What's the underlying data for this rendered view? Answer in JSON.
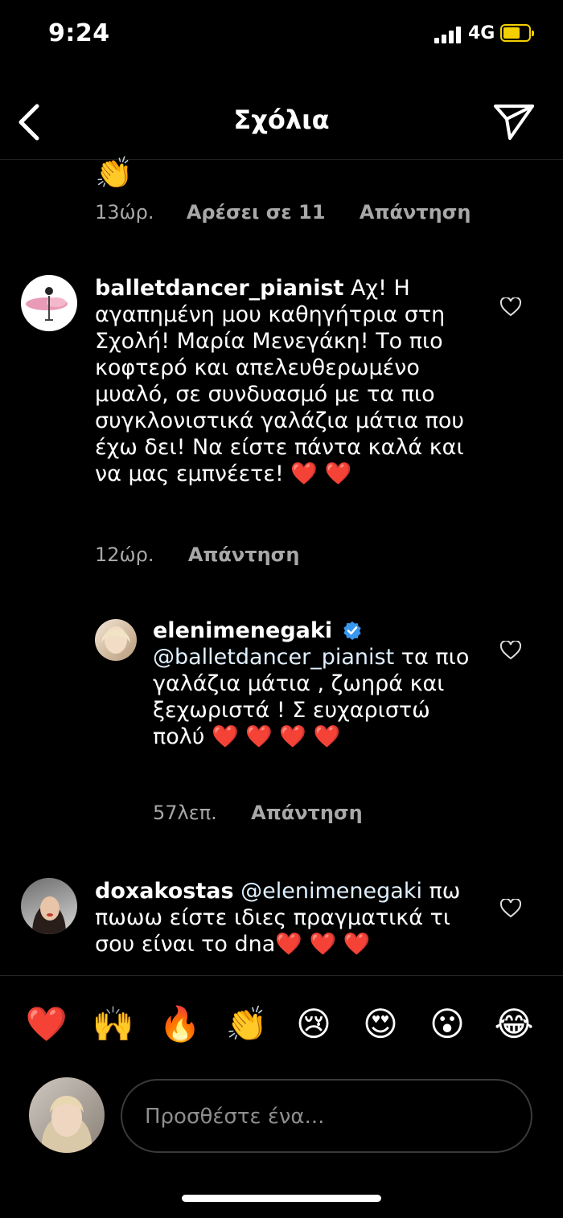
{
  "status": {
    "time": "9:24",
    "network": "4G"
  },
  "header": {
    "title": "Σχόλια"
  },
  "prev_comment": {
    "emoji": "👏",
    "time": "13ώρ.",
    "likes": "Αρέσει σε 11",
    "reply": "Απάντηση"
  },
  "comments": [
    {
      "username": "balletdancer_pianist",
      "text": "Αχ! Η αγαπημένη μου καθηγήτρια στη Σχολή! Μαρία Μενεγάκη! Το πιο κοφτερό και απελευθερωμένο μυαλό, σε συνδυασμό με τα πιο συγκλονιστικά γαλάζια μάτια που έχω δει! Να είστε πάντα καλά και να μας εμπνέετε! ❤️ ❤️",
      "time": "12ώρ.",
      "reply": "Απάντηση"
    },
    {
      "username": "elenimenegaki",
      "mention": "@balletdancer_pianist",
      "text": " τα πιο γαλάζια μάτια , ζωηρά και ξεχωριστά ! Σ ευχαριστώ πολύ ❤️ ❤️ ❤️ ❤️",
      "time": "57λεπ.",
      "reply": "Απάντηση"
    },
    {
      "username": "doxakostas",
      "mention": "@elenimenegaki",
      "text": " πω πωωω είστε ιδιες πραγματικά τι σου είναι το dna❤️ ❤️ ❤️"
    }
  ],
  "reactions": [
    "❤️",
    "🙌",
    "🔥",
    "👏",
    "😢",
    "😍",
    "😮",
    "😂"
  ],
  "composer": {
    "placeholder": "Προσθέστε ένα..."
  }
}
